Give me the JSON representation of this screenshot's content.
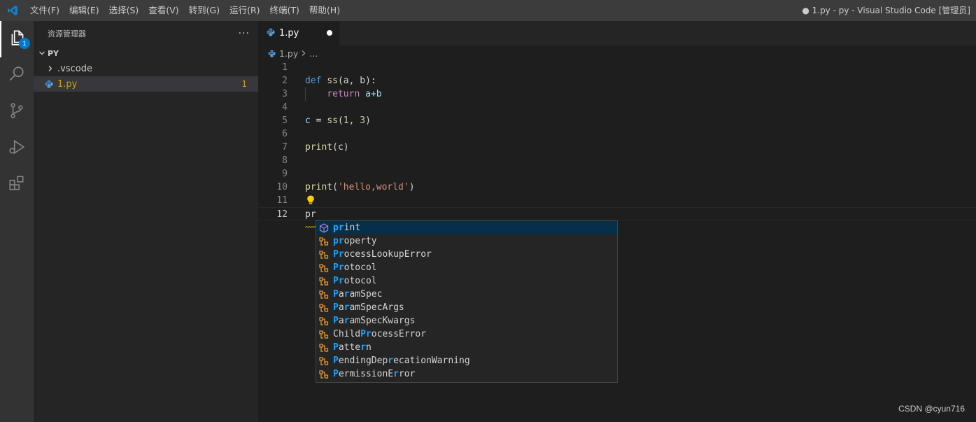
{
  "titlebar": {
    "menus": [
      "文件(F)",
      "编辑(E)",
      "选择(S)",
      "查看(V)",
      "转到(G)",
      "运行(R)",
      "终端(T)",
      "帮助(H)"
    ],
    "window_title": "● 1.py - py - Visual Studio Code [管理员]"
  },
  "activitybar": {
    "items": [
      "files-icon",
      "search-icon",
      "source-control-icon",
      "run-debug-icon",
      "extensions-icon"
    ],
    "explorer_badge": "1"
  },
  "sidebar": {
    "title": "资源管理器",
    "more": "···",
    "folder": "PY",
    "items": [
      {
        "label": ".vscode",
        "type": "folder"
      },
      {
        "label": "1.py",
        "type": "file",
        "problems": "1"
      }
    ]
  },
  "editor": {
    "tab_label": "1.py",
    "breadcrumb": {
      "file": "1.py",
      "rest": "..."
    },
    "line_numbers": [
      "1",
      "2",
      "3",
      "4",
      "5",
      "6",
      "7",
      "8",
      "9",
      "10",
      "11",
      "12"
    ],
    "code": {
      "l2_def": "def",
      "l2_name": "ss",
      "l2_rest": "(a, b):",
      "l3_return": "return",
      "l3_expr": "a+b",
      "l5_var": "c",
      "l5_eq": " = ",
      "l5_call": "ss",
      "l5_open": "(",
      "l5_n1": "1",
      "l5_comma": ", ",
      "l5_n2": "3",
      "l5_close": ")",
      "l7_call": "print",
      "l7_arg": "(c)",
      "l10_call": "print",
      "l10_open": "(",
      "l10_str": "'hello,world'",
      "l10_close": ")",
      "l12_text": "pr"
    }
  },
  "suggest": {
    "items": [
      {
        "hl1": "pr",
        "rest": "int",
        "kind": "function",
        "focused": true
      },
      {
        "hl1": "pr",
        "rest": "operty",
        "kind": "class"
      },
      {
        "hl1": "Pr",
        "rest": "ocessLookupError",
        "kind": "class"
      },
      {
        "hl1": "Pr",
        "rest": "otocol",
        "kind": "class"
      },
      {
        "hl1": "Pr",
        "rest": "otocol",
        "kind": "class"
      },
      {
        "parts": [
          [
            "P",
            true
          ],
          [
            "a",
            false
          ],
          [
            "r",
            true
          ],
          [
            "amSpec",
            false
          ]
        ],
        "kind": "class"
      },
      {
        "parts": [
          [
            "P",
            true
          ],
          [
            "a",
            false
          ],
          [
            "r",
            true
          ],
          [
            "amSpecArgs",
            false
          ]
        ],
        "kind": "class"
      },
      {
        "parts": [
          [
            "P",
            true
          ],
          [
            "a",
            false
          ],
          [
            "r",
            true
          ],
          [
            "amSpecKwargs",
            false
          ]
        ],
        "kind": "class"
      },
      {
        "parts": [
          [
            "Child",
            false
          ],
          [
            "Pr",
            true
          ],
          [
            "ocessError",
            false
          ]
        ],
        "kind": "class"
      },
      {
        "parts": [
          [
            "P",
            true
          ],
          [
            "atte",
            false
          ],
          [
            "r",
            true
          ],
          [
            "n",
            false
          ]
        ],
        "kind": "class"
      },
      {
        "parts": [
          [
            "P",
            true
          ],
          [
            "endingDep",
            false
          ],
          [
            "r",
            true
          ],
          [
            "ecationWarning",
            false
          ]
        ],
        "kind": "class"
      },
      {
        "parts": [
          [
            "P",
            true
          ],
          [
            "ermissionE",
            false
          ],
          [
            "r",
            true
          ],
          [
            "ror",
            false
          ]
        ],
        "kind": "class"
      }
    ]
  },
  "watermark": "CSDN @cyun716",
  "colors": {
    "accent": "#007acc",
    "warning": "#cca700",
    "keyword": "#569cd6",
    "string": "#ce9178"
  }
}
